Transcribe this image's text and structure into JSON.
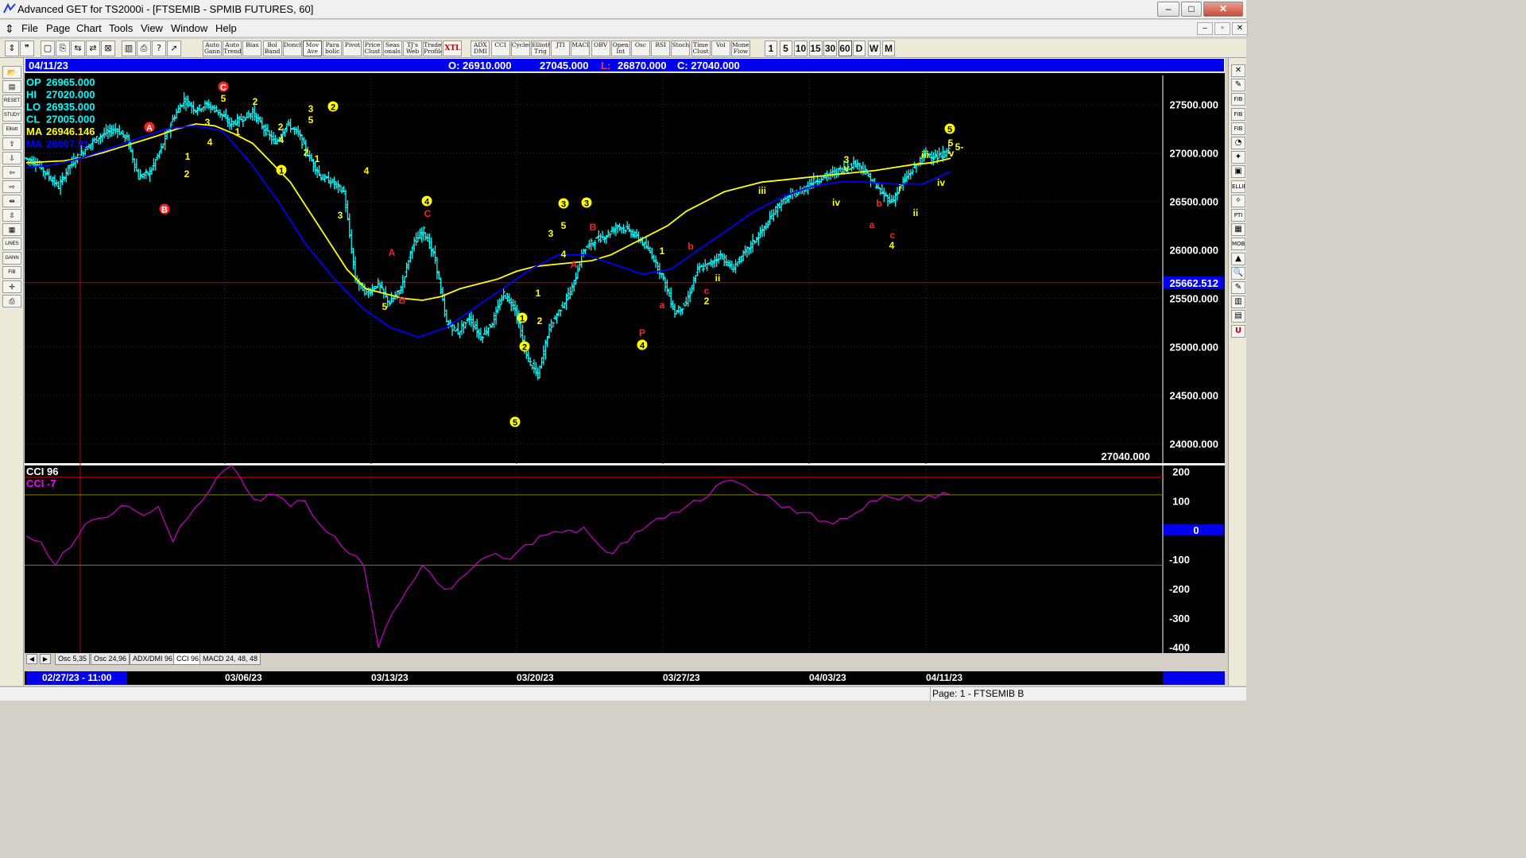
{
  "window": {
    "title": "Advanced GET for TS2000i - [FTSEMIB - SPMIB FUTURES, 60]",
    "controls": [
      "–",
      "□",
      "✕"
    ]
  },
  "menu": {
    "items": [
      "File",
      "Page",
      "Chart",
      "Tools",
      "View",
      "Window",
      "Help"
    ]
  },
  "toolbar": {
    "studies": [
      "Auto Gann",
      "Auto Trend",
      "Bias",
      "Bol Band",
      "Donch",
      "Mov Ave",
      "Para bolic",
      "Pivot",
      "Price Clust",
      "Seas onals",
      "TJ's Web",
      "Trade Profile",
      "XTL",
      "ADX DMI",
      "CCI",
      "Cycles",
      "Elliott Trig",
      "JTI",
      "MACD",
      "OBV",
      "Open Int",
      "Osc",
      "RSI",
      "Stoch",
      "Time Clust",
      "Vol",
      "Money Flow"
    ],
    "periods": [
      "1",
      "5",
      "10",
      "15",
      "30",
      "60",
      "D",
      "W",
      "M"
    ]
  },
  "left_toolbar": [
    "📂",
    "▤",
    "RESET",
    "STUDY",
    "Elliott",
    "⇧",
    "⇩",
    "⇦",
    "⇨",
    "⇹",
    "⇳",
    "▦",
    "LINES",
    "GANN",
    "FIB",
    "✛",
    "⎙"
  ],
  "right_toolbar": [
    "✕",
    "✎",
    "FIB RET",
    "FIB EXT",
    "FIB TIME",
    "◔",
    "✦",
    "▣",
    "ELLIPS",
    "✧",
    "PTI",
    "▦",
    "MOB",
    "▲",
    "🔍",
    "✎",
    "▥",
    "▤",
    "U"
  ],
  "infobar": {
    "date": "04/11/23",
    "open": "O: 26910.000",
    "high": "27045.000",
    "low_label": "L:",
    "low": "26870.000",
    "close": "C: 27040.000"
  },
  "ohlc_panel": [
    {
      "label": "OP",
      "value": "26965.000",
      "color": "#00ffff"
    },
    {
      "label": "HI",
      "value": "27020.000",
      "color": "#00ffff"
    },
    {
      "label": "LO",
      "value": "26935.000",
      "color": "#00ffff"
    },
    {
      "label": "CL",
      "value": "27005.000",
      "color": "#00ffff"
    },
    {
      "label": "MA",
      "value": "26946.146",
      "color": "#ffff00"
    },
    {
      "label": "MA",
      "value": "26807.917",
      "color": "#0000ff"
    }
  ],
  "price_axis": {
    "ticks": [
      "27500.000",
      "27000.000",
      "26500.000",
      "26000.000",
      "25500.000",
      "25000.000",
      "24500.000",
      "24000.000"
    ],
    "cursor_price": "25662.512",
    "last_close": "27040.000"
  },
  "cci_panel": {
    "title": "CCI 96",
    "value": "CCI  -7",
    "ticks": [
      "200",
      "100",
      "0",
      "-100",
      "-200",
      "-300",
      "-400"
    ]
  },
  "tabs": [
    "Osc 5,35",
    "Osc 24,96",
    "ADX/DMI 96",
    "CCI 96",
    "MACD 24, 48, 48"
  ],
  "dates": {
    "first": "02/27/23 - 11:00",
    "labels": [
      "03/06/23",
      "03/13/23",
      "03/20/23",
      "03/27/23",
      "04/03/23",
      "04/11/23"
    ]
  },
  "status": {
    "page": "Page: 1 - FTSEMIB B"
  },
  "elliott_labels": [
    {
      "t": "A",
      "c": "red",
      "circle": true
    },
    {
      "t": "B",
      "c": "red",
      "circle": true
    },
    {
      "t": "C",
      "c": "red",
      "circle": true
    },
    {
      "t": "5",
      "c": "yellow"
    },
    {
      "t": "2",
      "c": "yellow"
    },
    {
      "t": "3",
      "c": "yellow"
    },
    {
      "t": "4",
      "c": "yellow"
    },
    {
      "t": "1",
      "c": "yellow"
    },
    {
      "t": "2",
      "c": "yellow"
    },
    {
      "t": "1",
      "c": "yellow"
    },
    {
      "t": "2",
      "c": "yellow"
    },
    {
      "t": "4",
      "c": "yellow"
    },
    {
      "t": "3",
      "c": "yellow"
    },
    {
      "t": "5",
      "c": "yellow"
    },
    {
      "t": "1",
      "c": "yellow",
      "circle": true
    },
    {
      "t": "2",
      "c": "yellow",
      "circle": true
    },
    {
      "t": "2",
      "c": "yellow"
    },
    {
      "t": "1",
      "c": "yellow"
    },
    {
      "t": "4",
      "c": "yellow"
    },
    {
      "t": "3",
      "c": "yellow"
    },
    {
      "t": "A",
      "c": "red"
    },
    {
      "t": "5",
      "c": "yellow"
    },
    {
      "t": "B",
      "c": "red"
    },
    {
      "t": "3",
      "c": "yellow",
      "circle": true
    },
    {
      "t": "4",
      "c": "yellow",
      "circle": true
    },
    {
      "t": "C",
      "c": "red"
    },
    {
      "t": "5",
      "c": "yellow",
      "circle": true
    },
    {
      "t": "1",
      "c": "yellow",
      "circle": true
    },
    {
      "t": "2",
      "c": "yellow",
      "circle": true
    },
    {
      "t": "1",
      "c": "yellow"
    },
    {
      "t": "2",
      "c": "yellow"
    },
    {
      "t": "3",
      "c": "yellow",
      "circle": true
    },
    {
      "t": "3",
      "c": "yellow"
    },
    {
      "t": "5",
      "c": "yellow"
    },
    {
      "t": "4",
      "c": "yellow"
    },
    {
      "t": "A",
      "c": "red"
    },
    {
      "t": "B",
      "c": "red"
    },
    {
      "t": "1",
      "c": "yellow"
    },
    {
      "t": "P",
      "c": "red"
    },
    {
      "t": "4",
      "c": "yellow",
      "circle": true
    },
    {
      "t": "a",
      "c": "red"
    },
    {
      "t": "b",
      "c": "red"
    },
    {
      "t": "c",
      "c": "red"
    },
    {
      "t": "2",
      "c": "yellow"
    },
    {
      "t": "ii",
      "c": "yellow"
    },
    {
      "t": "iii",
      "c": "yellow"
    },
    {
      "t": "3",
      "c": "yellow"
    },
    {
      "t": "v",
      "c": "yellow"
    },
    {
      "t": "iv",
      "c": "yellow"
    },
    {
      "t": "b",
      "c": "red"
    },
    {
      "t": "a",
      "c": "red"
    },
    {
      "t": "c",
      "c": "red"
    },
    {
      "t": "4",
      "c": "yellow"
    },
    {
      "t": "i",
      "c": "yellow"
    },
    {
      "t": "ii",
      "c": "yellow"
    },
    {
      "t": "iii",
      "c": "yellow"
    },
    {
      "t": "iv",
      "c": "yellow"
    },
    {
      "t": "5",
      "c": "yellow",
      "circle": true
    },
    {
      "t": "5",
      "c": "yellow"
    },
    {
      "t": "v",
      "c": "yellow"
    },
    {
      "t": "5-",
      "c": "yellow"
    }
  ],
  "colors": {
    "price_bars": "#00ffff",
    "ma_fast": "#ffff00",
    "ma_slow": "#0000ff",
    "cci_line": "#c000c0",
    "infobar_bg": "#0000f0",
    "cursor_line": "#c00000",
    "background": "#000000"
  },
  "chart_data": {
    "type": "ohlc",
    "symbol": "FTSEMIB - SPMIB FUTURES",
    "interval": "60",
    "ylim": [
      23800,
      27800
    ],
    "x_labels": [
      "03/06/23",
      "03/13/23",
      "03/20/23",
      "03/27/23",
      "04/03/23",
      "04/11/23"
    ],
    "close_series": [
      26950,
      26900,
      26780,
      26650,
      26880,
      27000,
      27120,
      27200,
      27250,
      27150,
      26750,
      26800,
      27050,
      27350,
      27550,
      27450,
      27500,
      27430,
      27300,
      27350,
      27420,
      27250,
      27100,
      27300,
      27200,
      26950,
      26750,
      26700,
      26600,
      25700,
      25550,
      25650,
      25450,
      25600,
      26050,
      26200,
      25900,
      25250,
      25150,
      25300,
      25100,
      25250,
      25550,
      25400,
      24900,
      24700,
      25200,
      25400,
      25600,
      26000,
      26100,
      26150,
      26250,
      26200,
      26100,
      25950,
      25700,
      25350,
      25450,
      25800,
      25850,
      25950,
      25800,
      25950,
      26100,
      26250,
      26450,
      26550,
      26600,
      26700,
      26750,
      26800,
      26850,
      26900,
      26750,
      26600,
      26500,
      26700,
      26850,
      27000,
      26950,
      27020
    ],
    "ma_fast": [
      26900,
      26910,
      26920,
      26950,
      27000,
      27060,
      27120,
      27180,
      27250,
      27300,
      27280,
      27200,
      27100,
      26900,
      26700,
      26400,
      26100,
      25800,
      25600,
      25550,
      25500,
      25480,
      25520,
      25600,
      25650,
      25700,
      25780,
      25830,
      25850,
      25870,
      25890,
      25950,
      26050,
      26150,
      26250,
      26400,
      26500,
      26600,
      26650,
      26700,
      26720,
      26740,
      26760,
      26780,
      26800,
      26820,
      26850,
      26880,
      26900,
      26946
    ],
    "ma_slow": [
      26850,
      26880,
      26950,
      27050,
      27150,
      27250,
      27280,
      27230,
      26900,
      26500,
      26050,
      25700,
      25400,
      25200,
      25100,
      25200,
      25400,
      25600,
      25800,
      25950,
      25950,
      25850,
      25750,
      25800,
      26000,
      26200,
      26400,
      26550,
      26650,
      26700,
      26700,
      26680,
      26680,
      26808
    ],
    "cci_ylim": [
      -420,
      220
    ],
    "cci": [
      -20,
      -40,
      -120,
      -60,
      20,
      40,
      60,
      80,
      50,
      80,
      -40,
      40,
      100,
      180,
      220,
      140,
      100,
      120,
      80,
      100,
      20,
      -20,
      -80,
      -120,
      -400,
      -280,
      -200,
      -120,
      -180,
      -200,
      -150,
      -100,
      -80,
      -100,
      -50,
      -20,
      -5,
      0,
      10,
      -50,
      -80,
      -40,
      0,
      40,
      60,
      80,
      100,
      150,
      170,
      150,
      120,
      100,
      80,
      60,
      30,
      20,
      40,
      70,
      100,
      110,
      120,
      100,
      110,
      120
    ]
  }
}
